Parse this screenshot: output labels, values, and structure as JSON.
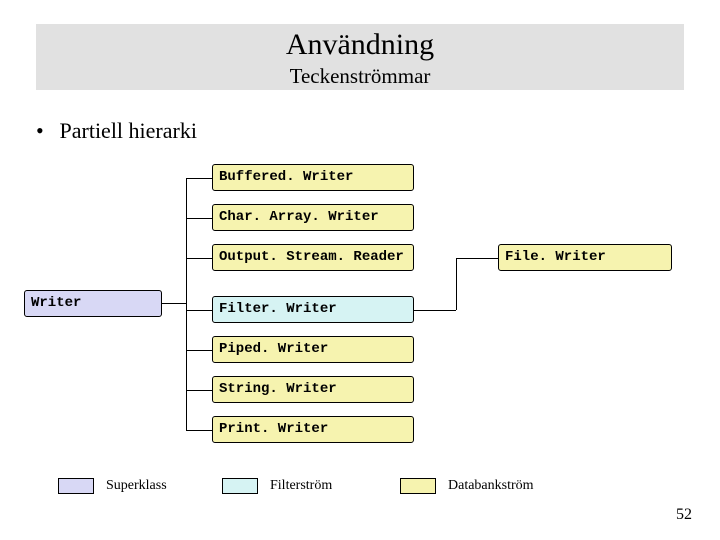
{
  "header": {
    "title": "Användning",
    "subtitle": "Teckenströmmar"
  },
  "bullet": "Partiell hierarki",
  "diagram": {
    "root": "Writer",
    "children": [
      "Buffered. Writer",
      "Char. Array. Writer",
      "Output. Stream. Reader",
      "Filter. Writer",
      "Piped. Writer",
      "String. Writer",
      "Print. Writer"
    ],
    "grandchild_of_filter": "File. Writer"
  },
  "legend": {
    "superclass": "Superklass",
    "filterstream": "Filterström",
    "databankstream": "Databankström"
  },
  "page_number": "52",
  "chart_data": {
    "type": "tree",
    "title": "Användning – Teckenströmmar – Partiell hierarki",
    "nodes": [
      {
        "id": "Writer",
        "category": "superclass"
      },
      {
        "id": "Buffered. Writer",
        "parent": "Writer",
        "category": "databankstream"
      },
      {
        "id": "Char. Array. Writer",
        "parent": "Writer",
        "category": "databankstream"
      },
      {
        "id": "Output. Stream. Reader",
        "parent": "Writer",
        "category": "databankstream"
      },
      {
        "id": "Filter. Writer",
        "parent": "Writer",
        "category": "filterstream"
      },
      {
        "id": "Piped. Writer",
        "parent": "Writer",
        "category": "databankstream"
      },
      {
        "id": "String. Writer",
        "parent": "Writer",
        "category": "databankstream"
      },
      {
        "id": "Print. Writer",
        "parent": "Writer",
        "category": "databankstream"
      },
      {
        "id": "File. Writer",
        "parent": "Filter. Writer",
        "category": "databankstream"
      }
    ],
    "categories": {
      "superclass": {
        "label": "Superklass",
        "color": "#d8d8f5"
      },
      "filterstream": {
        "label": "Filterström",
        "color": "#d6f3f3"
      },
      "databankstream": {
        "label": "Databankström",
        "color": "#f6f3af"
      }
    }
  }
}
